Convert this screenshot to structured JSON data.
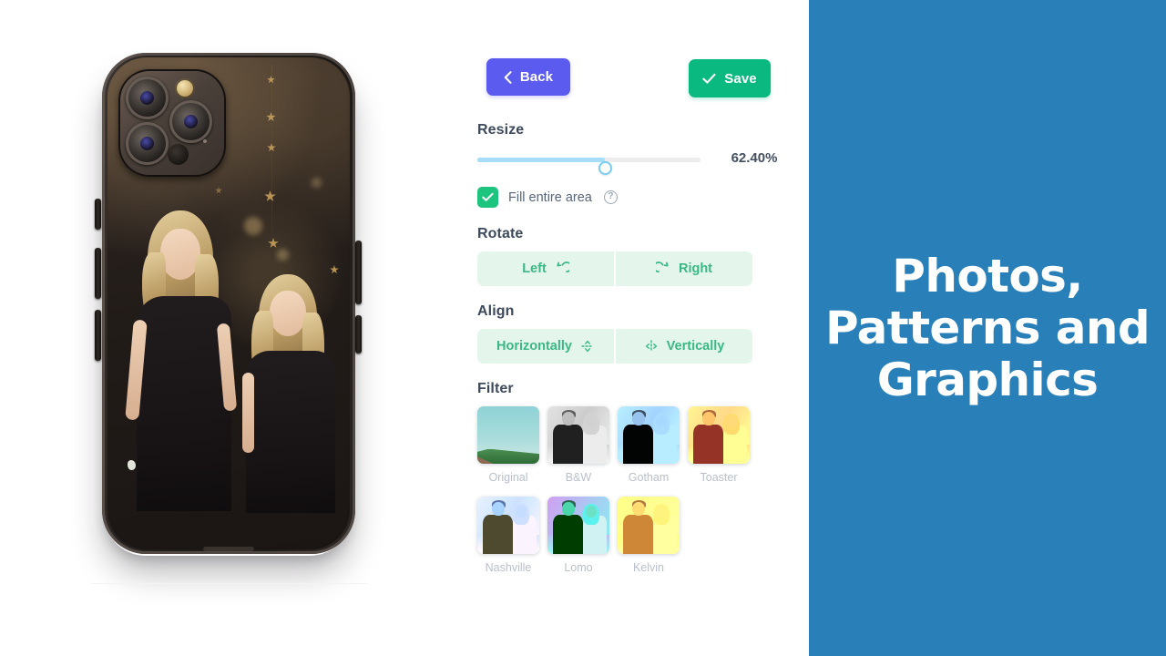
{
  "toolbar": {
    "back_label": "Back",
    "back_icon": "chevron-left-icon",
    "back_color": "#5b5bef",
    "save_label": "Save",
    "save_icon": "check-icon",
    "save_color": "#0ab97f"
  },
  "resize": {
    "title": "Resize",
    "value_label": "62.40%",
    "slider_percent": 57,
    "track_color": "#ececee",
    "fill_color": "#a6ddf8",
    "thumb_color": "#79cdf0"
  },
  "fill_area": {
    "label": "Fill entire area",
    "checked": true,
    "checkbox_color": "#1dc47e",
    "help_icon": "question-mark-icon",
    "help_glyph": "?"
  },
  "rotate": {
    "title": "Rotate",
    "left_label": "Left",
    "left_icon": "rotate-left-icon",
    "right_label": "Right",
    "right_icon": "rotate-right-icon",
    "pill_bg": "#e4f6ec",
    "pill_text": "#3ab884"
  },
  "align": {
    "title": "Align",
    "horizontal_label": "Horizontally",
    "horizontal_icon": "align-horizontal-icon",
    "vertical_label": "Vertically",
    "vertical_icon": "align-vertical-icon"
  },
  "filter": {
    "title": "Filter",
    "items": [
      {
        "name": "Original",
        "thumb": "house-teal-sky"
      },
      {
        "name": "B&W",
        "thumb": "couple-grayscale"
      },
      {
        "name": "Gotham",
        "thumb": "couple-blue-dark"
      },
      {
        "name": "Toaster",
        "thumb": "couple-warm-red"
      },
      {
        "name": "Nashville",
        "thumb": "couple-blue-violet"
      },
      {
        "name": "Lomo",
        "thumb": "couple-teal-contrast"
      },
      {
        "name": "Kelvin",
        "thumb": "couple-amber"
      }
    ]
  },
  "preview": {
    "product": "phone-case-preview",
    "artwork": "photo-two-girls-black-dresses-gold-stars"
  },
  "promo": {
    "headline": "Photos,\nPatterns and\nGraphics",
    "background_color": "#2980b9",
    "text_color": "#ffffff"
  }
}
